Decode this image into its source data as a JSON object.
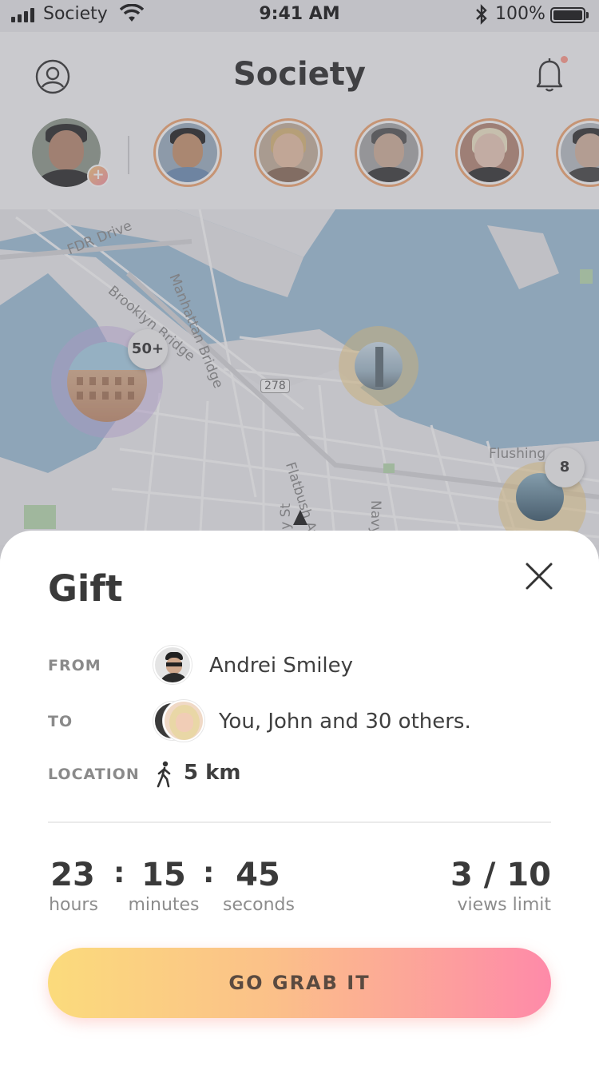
{
  "status_bar": {
    "carrier": "Society",
    "time": "9:41 AM",
    "battery": "100%"
  },
  "header": {
    "title": "Society"
  },
  "map": {
    "labels": {
      "fdr_drive": "FDR Drive",
      "manhattan_bridge": "Manhattan Bridge",
      "brooklyn_bridge": "Brooklyn Bridge",
      "highway": "278",
      "flatbush": "Flatbush Av",
      "jay_st": "Jay St",
      "navy": "Navy",
      "flushing": "Flushing"
    },
    "clusters": {
      "left_count": "50+",
      "right_count": "8"
    }
  },
  "gift": {
    "title": "Gift",
    "from_label": "FROM",
    "from_name": "Andrei Smiley",
    "to_label": "TO",
    "to_text": "You, John and 30 others.",
    "location_label": "LOCATION",
    "location_distance": "5 km"
  },
  "timer": {
    "hours": "23",
    "hours_label": "hours",
    "minutes": "15",
    "minutes_label": "minutes",
    "seconds": "45",
    "seconds_label": "seconds",
    "separator": ":"
  },
  "views": {
    "value": "3 / 10",
    "label": "views limit"
  },
  "cta": {
    "label": "GO GRAB IT"
  },
  "colors": {
    "accent_start": "#fbdb7c",
    "accent_end": "#fe8aa9",
    "water": "#9ec0d8"
  },
  "icons": [
    "signal-icon",
    "wifi-icon",
    "bluetooth-icon",
    "battery-icon",
    "profile-icon",
    "bell-icon",
    "close-icon",
    "walking-icon"
  ]
}
